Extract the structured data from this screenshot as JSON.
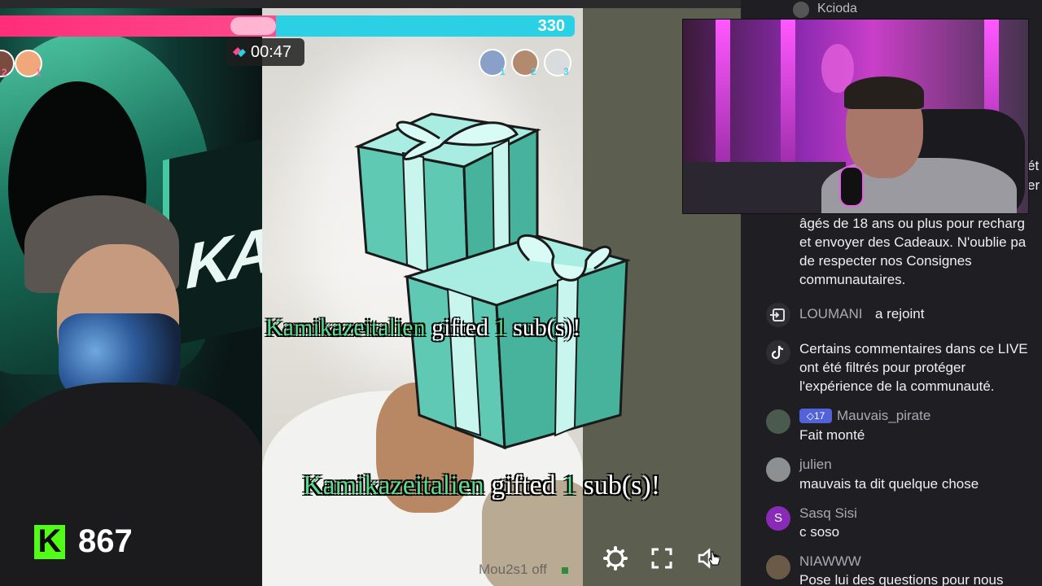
{
  "battle": {
    "score_right": "330",
    "timer": "00:47",
    "left_fraction": 0.48
  },
  "left_stream": {
    "kick_logo_letter": "K",
    "viewer_count": "867",
    "banner_text": "KAI",
    "avatar_badges": [
      "2",
      "1"
    ]
  },
  "middle_stream": {
    "avatar_badges": [
      "1",
      "2",
      "3"
    ],
    "watermark": "Mou2s1 off"
  },
  "overlay": {
    "gift_message_1": {
      "name": "Kamikazeitalien",
      "verb": "gifted",
      "count": "1",
      "suffix": "sub(s)!"
    },
    "gift_message_2": {
      "name": "Kamikazeitalien",
      "verb": "gifted",
      "count": "1",
      "suffix": "sub(s)!"
    }
  },
  "controls": {
    "settings_icon": "gear-icon",
    "fullscreen_icon": "fullscreen-icon",
    "volume_icon": "volume-icon"
  },
  "chat": {
    "top_user": "Kcioda",
    "partial_right_1": "ét",
    "partial_right_2": "er",
    "system_message": [
      "âgés de 18 ans ou plus pour recharg",
      "et envoyer des Cadeaux. N'oublie pa",
      "de respecter nos Consignes",
      "communautaires."
    ],
    "joined": {
      "user": "LOUMANI",
      "text": "a rejoint"
    },
    "filter_notice": [
      "Certains commentaires dans ce LIVE",
      "ont été filtrés pour protéger",
      "l'expérience de la communauté."
    ],
    "messages": [
      {
        "user": "Mauvais_pirate",
        "badge": "17",
        "text": "Fait monté"
      },
      {
        "user": "julien",
        "text": "mauvais ta dit quelque chose"
      },
      {
        "user": "Sasq Sisi",
        "avatar_letter": "S",
        "text": "c soso"
      },
      {
        "user": "NIAWWW",
        "text": "Pose lui des questions pour nous"
      }
    ]
  },
  "colors": {
    "kick_green": "#53fc18",
    "battle_pink": "#ff2d7a",
    "battle_cyan": "#2ad0e4",
    "gift_green": "#59d98a",
    "gift_box": "#5fc9b3",
    "chat_bg": "#1f1f23"
  }
}
